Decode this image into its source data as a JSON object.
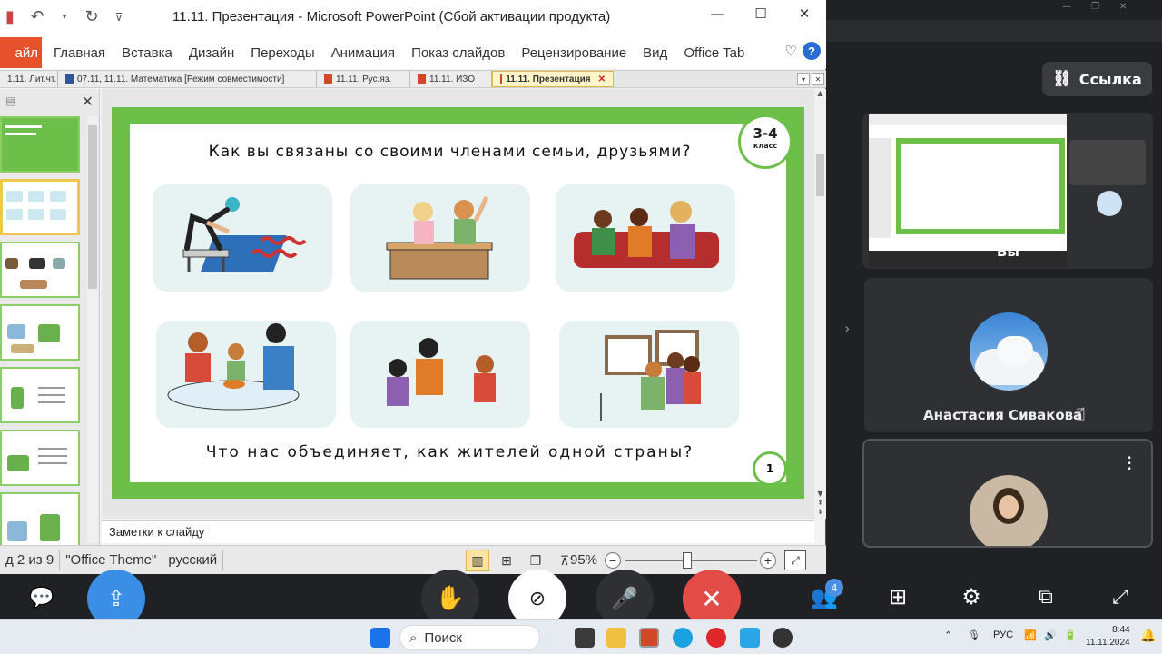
{
  "ppt": {
    "window_title": "11.11. Презентация  -  Microsoft PowerPoint (Сбой активации продукта)",
    "qat_icons": [
      "save-icon",
      "undo-icon",
      "redo-icon",
      "customize-icon"
    ],
    "file_tab": "айл",
    "ribbon_tabs": [
      "Главная",
      "Вставка",
      "Дизайн",
      "Переходы",
      "Анимация",
      "Показ слайдов",
      "Рецензирование",
      "Вид",
      "Office Tab"
    ],
    "doc_tabs": [
      {
        "label": "1.11. Лит.чт."
      },
      {
        "label": "07.11, 11.11. Математика [Режим совместимости]"
      },
      {
        "label": "11.11. Рус.яз."
      },
      {
        "label": "11.11. ИЗО"
      },
      {
        "label": "11.11. Презентация",
        "active": true
      }
    ],
    "slide": {
      "question_top": "Как вы связаны со своими членами семьи, друзьями?",
      "question_bottom": "Что нас объединяет, как жителей одной страны?",
      "grade_number": "3-4",
      "grade_word": "класс",
      "page_number": "1"
    },
    "notes_placeholder": "Заметки к слайду",
    "status": {
      "slide_counter": "д 2 из 9",
      "theme": "\"Office Theme\"",
      "language": "русский",
      "zoom": "95%",
      "zoom_fraction": 0.5
    }
  },
  "meeting": {
    "link_label": "Ссылка",
    "you_label": "Вы",
    "participant_name": "Анастасия Сивакова",
    "participants_count": "4",
    "end_call_color": "#e24b46",
    "share_color": "#3a8ee6"
  },
  "taskbar": {
    "search_label": "Поиск",
    "language": "РУС",
    "time": "8:44",
    "date": "11.11.2024"
  }
}
